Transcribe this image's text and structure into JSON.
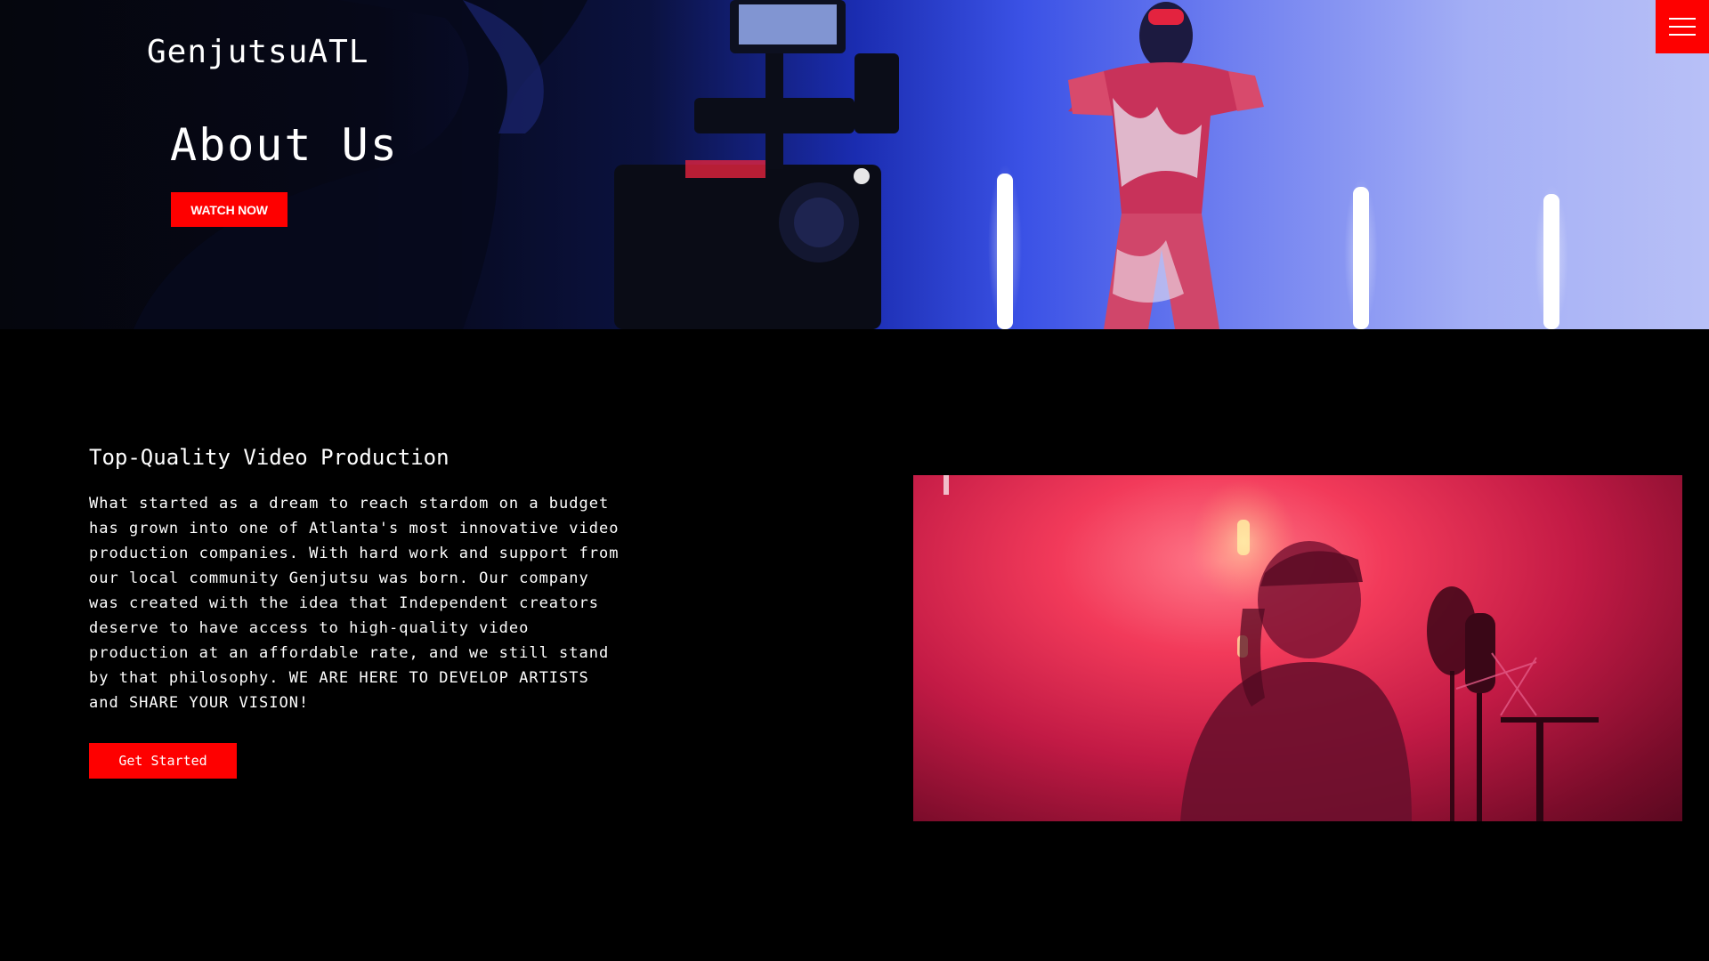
{
  "header": {
    "brand": "GenjutsuATL",
    "menu_icon": "hamburger-menu-icon"
  },
  "hero": {
    "title": "About Us",
    "cta_label": "WATCH NOW",
    "image": "camera-operator-filming-performer-photo"
  },
  "main": {
    "heading": "Top-Quality Video Production",
    "body": "What started as a dream to reach stardom on a budget has grown into one of Atlanta's most innovative video production companies. With hard work and support from our local community Genjutsu was born. Our company was created with the idea that Independent creators deserve to have access to high-quality video production at an affordable rate, and we still stand by that philosophy. WE ARE HERE TO DEVELOP ARTISTS and SHARE YOUR VISION!",
    "cta_label": "Get Started",
    "image": "recording-studio-artist-photo"
  },
  "colors": {
    "accent": "#fe0000",
    "background": "#000000",
    "text": "#ffffff"
  }
}
